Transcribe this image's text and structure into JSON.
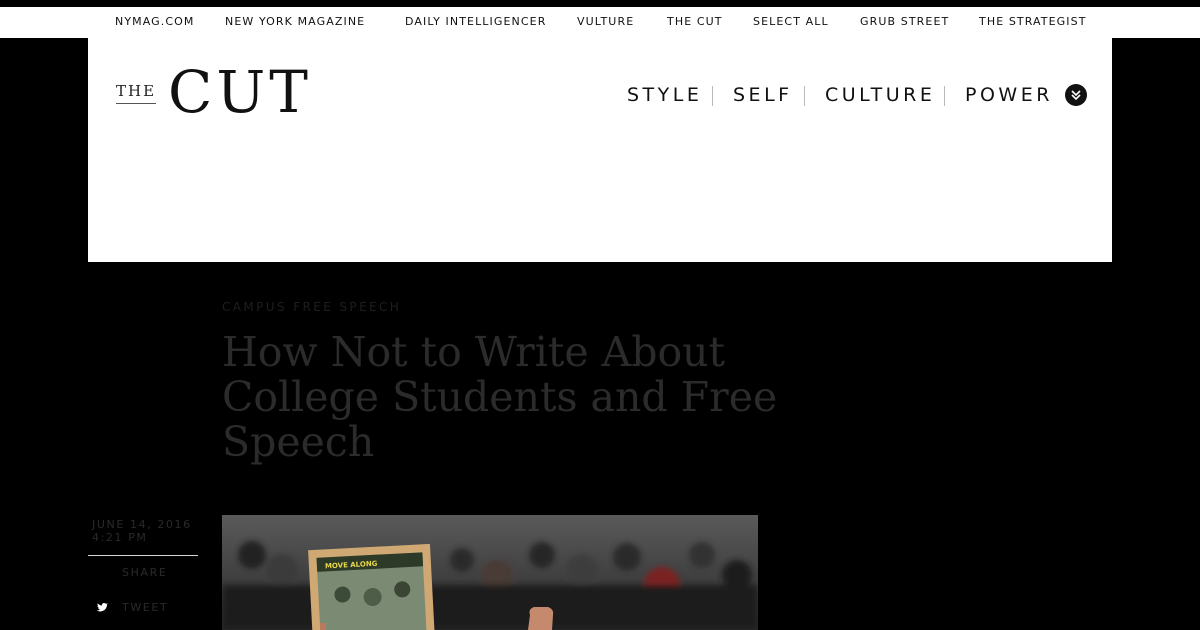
{
  "network_bar": {
    "links": [
      "NYMAG.COM",
      "NEW YORK MAGAZINE",
      "DAILY INTELLIGENCER",
      "VULTURE",
      "THE CUT",
      "SELECT ALL",
      "GRUB STREET",
      "THE STRATEGIST"
    ]
  },
  "header": {
    "logo_the": "THE",
    "logo_cut": "CUT",
    "nav": [
      "STYLE",
      "SELF",
      "CULTURE",
      "POWER"
    ],
    "menu_icon": "double-chevron-down-icon"
  },
  "article": {
    "rubric": "CAMPUS FREE SPEECH",
    "headline": "How Not to Write About College Students and Free Speech",
    "date": "JUNE 14, 2016",
    "time": "4:21 PM",
    "share_label": "SHARE",
    "tweet_label": "TWEET",
    "tweet_icon": "twitter-icon",
    "photo_sign_text": "MOVE ALONG"
  },
  "colors": {
    "page_bg": "#000000",
    "header_bg": "#ffffff",
    "dim_text": "#2b2b2b"
  }
}
